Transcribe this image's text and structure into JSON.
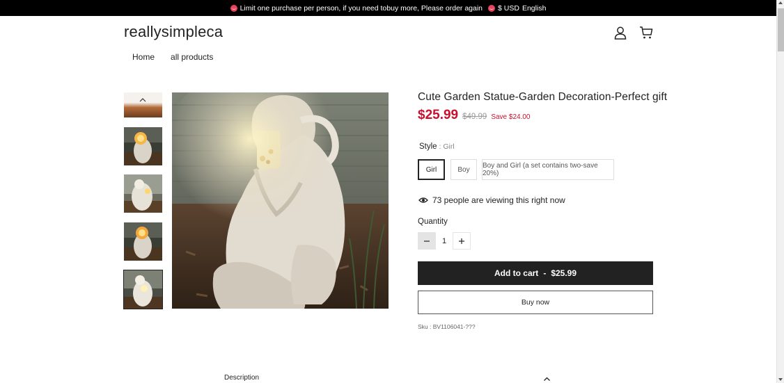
{
  "announcement": {
    "text": "Limit one purchase per person, if you need tobuy more, Please order again",
    "currency": "$ USD",
    "language": "English"
  },
  "header": {
    "logo": "reallysimpleca",
    "icons": [
      "user-icon",
      "cart-icon"
    ]
  },
  "nav": {
    "items": [
      {
        "label": "Home"
      },
      {
        "label": "all products"
      }
    ]
  },
  "product": {
    "title": "Cute Garden Statue-Garden Decoration-Perfect gift",
    "price": "$25.99",
    "compare_price": "$49.99",
    "save": "Save $24.00",
    "style_label": "Style",
    "style_sep": " : ",
    "style_value": "Girl",
    "options": [
      {
        "label": "Girl",
        "selected": true
      },
      {
        "label": "Boy",
        "selected": false
      },
      {
        "label": "Boy and Girl (a set contains two-save 20%)",
        "selected": false
      }
    ],
    "viewing": "73 people are viewing this right now",
    "quantity_label": "Quantity",
    "quantity": "1",
    "add_to_cart": "Add to cart",
    "add_to_cart_sep": "-",
    "add_to_cart_price": "$25.99",
    "buy_now": "Buy now",
    "sku": "Sku : BV1106041-???"
  },
  "description": {
    "label": "Description"
  },
  "colors": {
    "price": "#c8102e",
    "button_bg": "#222222",
    "announce_bg": "#000000"
  }
}
